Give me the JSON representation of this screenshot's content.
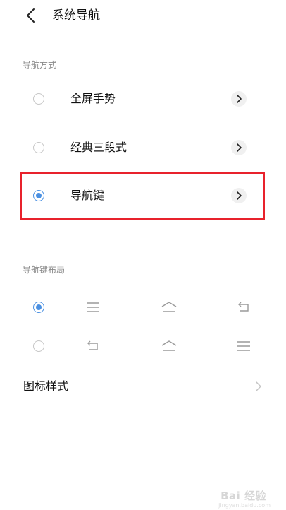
{
  "header": {
    "title": "系统导航"
  },
  "navigation_method": {
    "section_title": "导航方式",
    "options": [
      {
        "label": "全屏手势",
        "selected": false
      },
      {
        "label": "经典三段式",
        "selected": false
      },
      {
        "label": "导航键",
        "selected": true
      }
    ]
  },
  "nav_key_layout": {
    "section_title": "导航键布局",
    "layouts": [
      {
        "selected": true,
        "icons": [
          "menu-lines-icon",
          "home-icon",
          "back-icon"
        ]
      },
      {
        "selected": false,
        "icons": [
          "back-icon",
          "home-icon",
          "menu-lines-icon"
        ]
      }
    ]
  },
  "icon_style": {
    "label": "图标样式"
  },
  "watermark": {
    "text": "Bai 经验",
    "sub": "jingyan.baidu.com"
  },
  "colors": {
    "accent": "#4a90e2",
    "highlight": "#e8222c",
    "muted": "#8a8a8a"
  }
}
